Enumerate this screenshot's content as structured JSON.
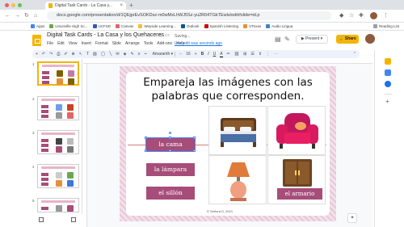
{
  "browser": {
    "tab_title": "Digital Task Cards - La Casa y...",
    "tab_close": "×",
    "new_tab": "+",
    "url": "docs.google.com/presentation/d/1QEjprEvSOKDsz-m0wMxLhWJ5Sz-yu2R04TGkTEwls/edit#slide=id.p",
    "bookmarks": [
      "Apps",
      "Unionville High Sc...",
      "UCFSD",
      "Canvas",
      "Weyside Learning...",
      "Outlook",
      "Spanish Listening",
      "UTexas",
      "Audio Lingua"
    ],
    "reading_list": "Reading List"
  },
  "app": {
    "title": "Digital Task Cards - La Casa y los Quehaceres",
    "saving": "Saving...",
    "last_edit": "Last edit was seconds ago",
    "menu": [
      "File",
      "Edit",
      "View",
      "Insert",
      "Format",
      "Slide",
      "Arrange",
      "Tools",
      "Add-ons",
      "Help"
    ],
    "present_label": "Present",
    "share_label": "Share",
    "toolbar": {
      "font": "Amaranth",
      "font_size": "16",
      "bold": "B",
      "italic": "I",
      "underline": "U",
      "text_color": "A"
    }
  },
  "filmstrip": {
    "slides": [
      1,
      2,
      3,
      4,
      5
    ]
  },
  "slide": {
    "heading_line1": "Empareja las imágenes con las",
    "heading_line2": "palabras que corresponden.",
    "tags": [
      "la cama",
      "la lámpara",
      "el sillón"
    ],
    "answer": "el armario",
    "credit": "© Señora D, 2021",
    "images": [
      "bed-image",
      "armchair-image",
      "lamp-image",
      "wardrobe-image"
    ]
  },
  "colors": {
    "accent": "#a64d79",
    "share": "#f4b400"
  }
}
